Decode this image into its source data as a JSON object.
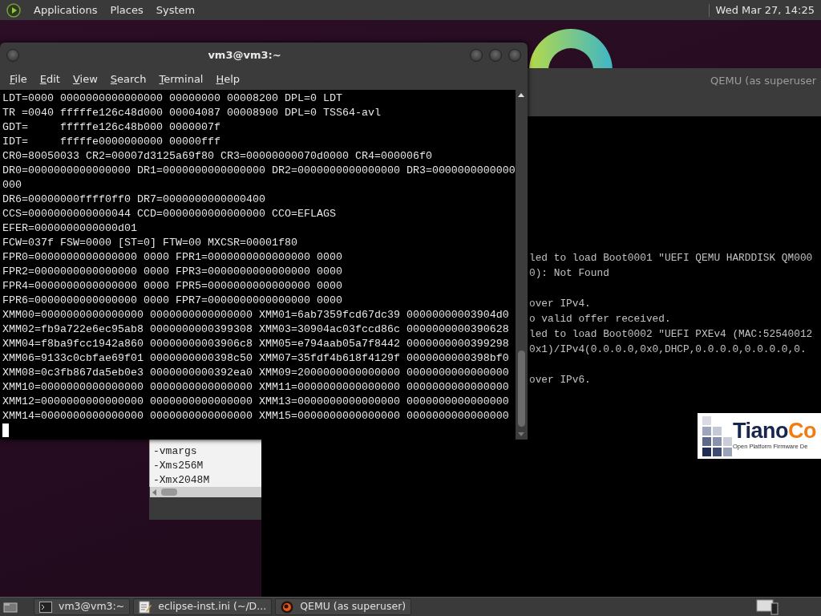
{
  "top_panel": {
    "menus": [
      "Applications",
      "Places",
      "System"
    ],
    "clock": "Wed Mar 27, 14:25"
  },
  "terminal": {
    "title": "vm3@vm3:~",
    "menu": [
      "File",
      "Edit",
      "View",
      "Search",
      "Terminal",
      "Help"
    ],
    "lines": [
      "LDT=0000 0000000000000000 00000000 00008200 DPL=0 LDT",
      "TR =0040 fffffe126c48d000 00004087 00008900 DPL=0 TSS64-avl",
      "GDT=     fffffe126c48b000 0000007f",
      "IDT=     fffffe0000000000 00000fff",
      "CR0=80050033 CR2=00007d3125a69f80 CR3=00000000070d0000 CR4=000006f0",
      "DR0=0000000000000000 DR1=0000000000000000 DR2=0000000000000000 DR3=0000000000000",
      "000",
      "DR6=00000000ffff0ff0 DR7=0000000000000400",
      "CCS=0000000000000044 CCD=0000000000000000 CCO=EFLAGS",
      "EFER=0000000000000d01",
      "FCW=037f FSW=0000 [ST=0] FTW=00 MXCSR=00001f80",
      "FPR0=0000000000000000 0000 FPR1=0000000000000000 0000",
      "FPR2=0000000000000000 0000 FPR3=0000000000000000 0000",
      "FPR4=0000000000000000 0000 FPR5=0000000000000000 0000",
      "FPR6=0000000000000000 0000 FPR7=0000000000000000 0000",
      "XMM00=0000000000000000 0000000000000000 XMM01=6ab7359fcd67dc39 00000000003904d0",
      "XMM02=fb9a722e6ec95ab8 0000000000399308 XMM03=30904ac03fccd86c 0000000000390628",
      "XMM04=f8ba9fcc1942a860 00000000003906c8 XMM05=e794aab05a7f8442 0000000000399298",
      "XMM06=9133c0cbfae69f01 0000000000398c50 XMM07=35fdf4b618f4129f 0000000000398bf0",
      "XMM08=0c3fb867da5eb0e3 0000000000392ea0 XMM09=2000000000000000 0000000000000000",
      "XMM10=0000000000000000 0000000000000000 XMM11=0000000000000000 0000000000000000",
      "XMM12=0000000000000000 0000000000000000 XMM13=0000000000000000 0000000000000000",
      "XMM14=0000000000000000 0000000000000000 XMM15=0000000000000000 0000000000000000"
    ]
  },
  "editor": {
    "lines": [
      "-vmargs",
      "-Xms256M",
      "-Xmx2048M"
    ]
  },
  "qemu": {
    "title": "QEMU (as superuser",
    "blocks": [
      [
        "led to load Boot0001 \"UEFI QEMU HARDDISK QM000",
        "0): Not Found"
      ],
      [
        "over IPv4.",
        "o valid offer received.",
        "led to load Boot0002 \"UEFI PXEv4 (MAC:52540012",
        "0x1)/IPv4(0.0.0.0,0x0,DHCP,0.0.0.0,0.0.0.0,0."
      ],
      [
        "over IPv6."
      ]
    ],
    "logo": {
      "brand": "Tiano",
      "brand_suffix": "Co",
      "tagline": "Open Platform Firmware De"
    }
  },
  "taskbar": {
    "tasks": [
      {
        "label": "vm3@vm3:~",
        "kind": "terminal"
      },
      {
        "label": "eclipse-inst.ini (~/D...",
        "kind": "editor"
      },
      {
        "label": "QEMU (as superuser)",
        "kind": "qemu"
      }
    ]
  }
}
